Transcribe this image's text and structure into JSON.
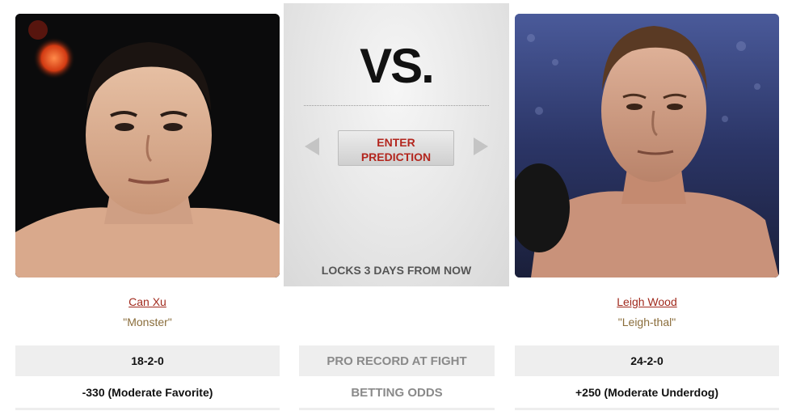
{
  "center": {
    "vs_text": "VS.",
    "enter_prediction": "ENTER PREDICTION",
    "locks_text": "LOCKS 3 DAYS FROM NOW"
  },
  "fighters": [
    {
      "name": "Can Xu",
      "nickname": "\"Monster\"",
      "record": "18-2-0",
      "odds": "-330 (Moderate Favorite)"
    },
    {
      "name": "Leigh Wood",
      "nickname": "\"Leigh-thal\"",
      "record": "24-2-0",
      "odds": "+250 (Moderate Underdog)"
    }
  ],
  "stats_labels": {
    "record": "PRO RECORD AT FIGHT",
    "odds": "BETTING ODDS"
  },
  "colors": {
    "accent_red": "#b3261e",
    "name_link": "#a12a1d",
    "nickname": "#8a6d3b",
    "row_bg": "#eeeeee"
  },
  "icons": {
    "prev": "triangle-left-icon",
    "next": "triangle-right-icon"
  }
}
